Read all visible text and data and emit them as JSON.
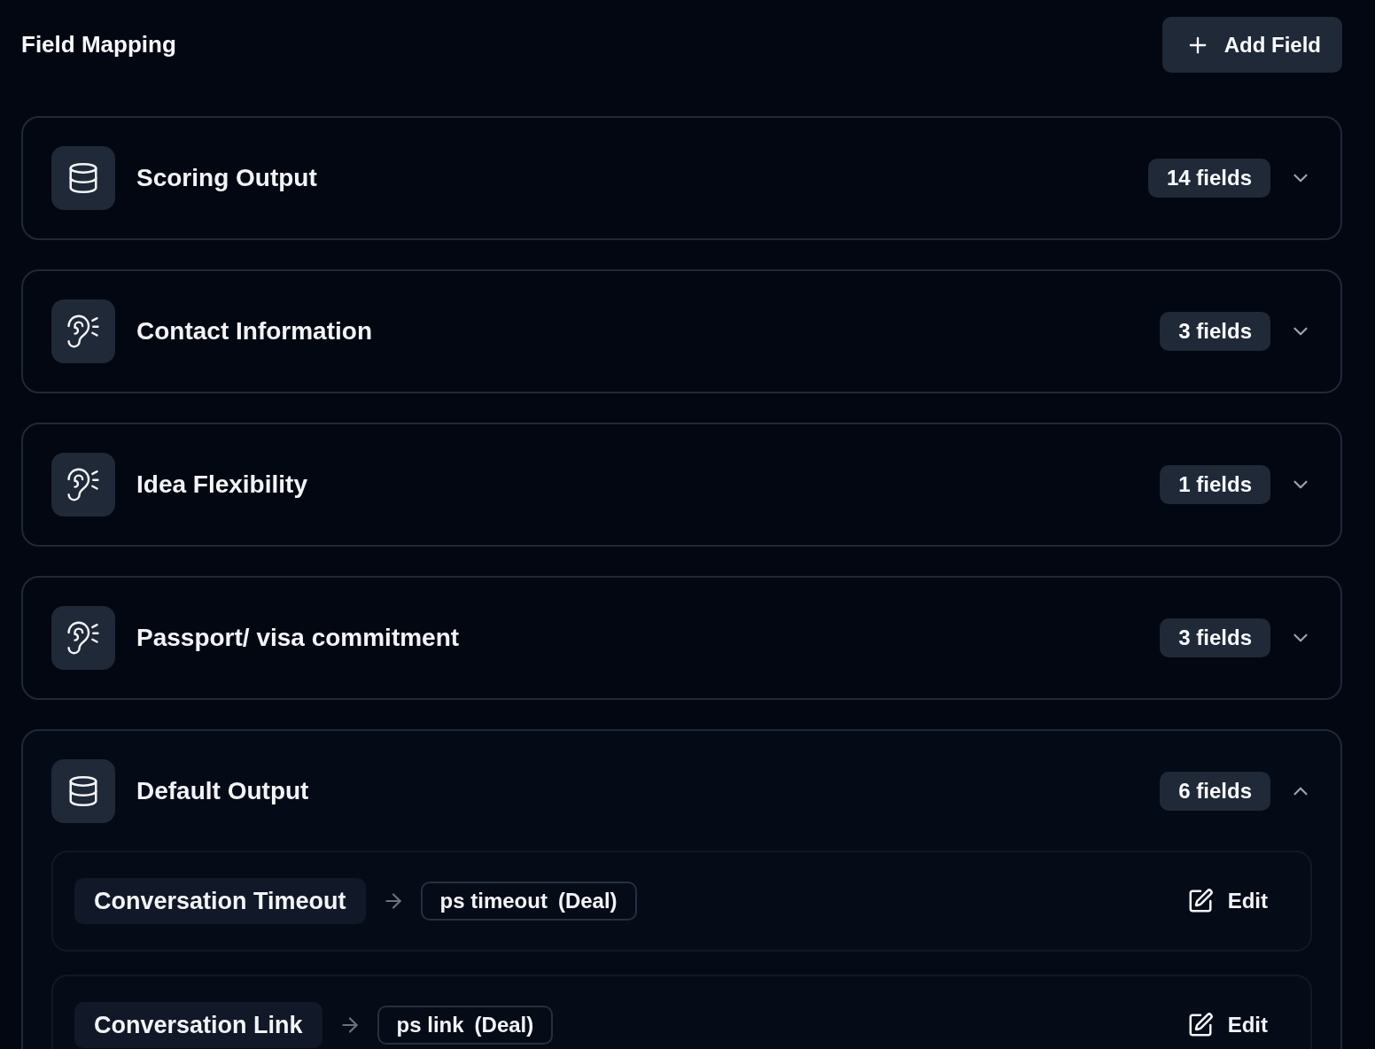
{
  "header": {
    "title": "Field Mapping",
    "add_button": "Add Field"
  },
  "groups": [
    {
      "kind": "database",
      "title": "Scoring Output",
      "count": "14 fields",
      "expanded": false
    },
    {
      "kind": "ear",
      "title": "Contact Information",
      "count": "3 fields",
      "expanded": false
    },
    {
      "kind": "ear",
      "title": "Idea Flexibility",
      "count": "1 fields",
      "expanded": false
    },
    {
      "kind": "ear",
      "title": "Passport/ visa commitment",
      "count": "3 fields",
      "expanded": false
    },
    {
      "kind": "database",
      "title": "Default Output",
      "count": "6 fields",
      "expanded": true,
      "fields": [
        {
          "source": "Conversation Timeout",
          "target": "ps timeout",
          "entity": "(Deal)",
          "action": "Edit"
        },
        {
          "source": "Conversation Link",
          "target": "ps link",
          "entity": "(Deal)",
          "action": "Edit"
        }
      ]
    }
  ]
}
